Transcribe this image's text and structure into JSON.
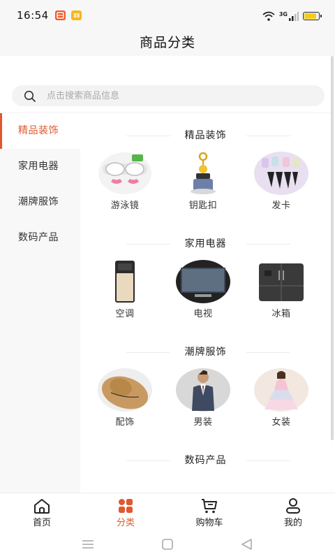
{
  "status_bar": {
    "time": "16:54",
    "network_label": "3G",
    "battery_level": 0.85,
    "notification_icons": [
      "app-notification-icon",
      "app-notification-icon"
    ],
    "colors": {
      "notif_1": "#f05a2a",
      "notif_2": "#f4b81e",
      "battery": "#f4cc1a"
    }
  },
  "header": {
    "title": "商品分类"
  },
  "search": {
    "placeholder": "点击搜索商品信息",
    "value": ""
  },
  "sidebar": {
    "items": [
      {
        "label": "精品装饰",
        "active": true
      },
      {
        "label": "家用电器",
        "active": false
      },
      {
        "label": "潮牌服饰",
        "active": false
      },
      {
        "label": "数码产品",
        "active": false
      }
    ]
  },
  "sections": [
    {
      "title": "精品装饰",
      "items": [
        {
          "label": "游泳镜",
          "icon": "swim-goggles-image"
        },
        {
          "label": "钥匙扣",
          "icon": "keychain-image"
        },
        {
          "label": "发卡",
          "icon": "hairclip-image"
        }
      ]
    },
    {
      "title": "家用电器",
      "items": [
        {
          "label": "空调",
          "icon": "air-conditioner-image"
        },
        {
          "label": "电视",
          "icon": "tv-image"
        },
        {
          "label": "冰箱",
          "icon": "fridge-image"
        }
      ]
    },
    {
      "title": "潮牌服饰",
      "items": [
        {
          "label": "配饰",
          "icon": "hat-image"
        },
        {
          "label": "男装",
          "icon": "menswear-image"
        },
        {
          "label": "女装",
          "icon": "womenswear-image"
        }
      ]
    },
    {
      "title": "数码产品",
      "items": []
    }
  ],
  "tab_bar": {
    "items": [
      {
        "label": "首页",
        "icon": "home-icon",
        "active": false
      },
      {
        "label": "分类",
        "icon": "category-icon",
        "active": true
      },
      {
        "label": "购物车",
        "icon": "cart-icon",
        "active": false
      },
      {
        "label": "我的",
        "icon": "profile-icon",
        "active": false
      }
    ]
  },
  "system_nav": {
    "icons": [
      "menu-icon",
      "home-square-icon",
      "back-triangle-icon"
    ]
  },
  "colors": {
    "accent": "#e0582c",
    "sidebar_bg": "#f8f8f8",
    "search_bg": "#f3f3f3"
  }
}
